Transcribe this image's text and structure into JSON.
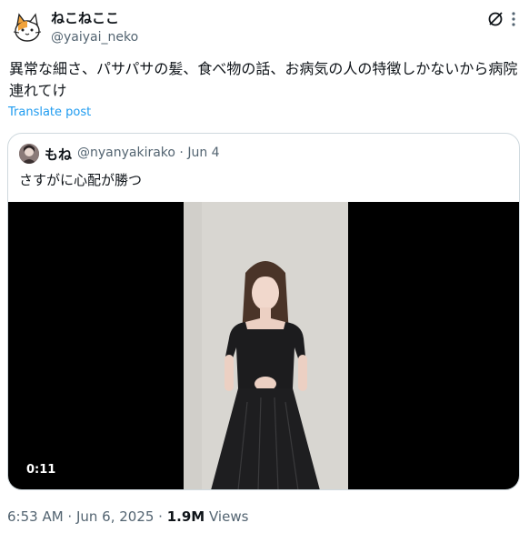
{
  "author": {
    "display_name": "ねこねここ",
    "handle": "@yaiyai_neko",
    "avatar_icon": "cat-avatar-icon"
  },
  "actions": {
    "grok_icon": "grok-icon",
    "more_icon": "more-icon"
  },
  "tweet": {
    "text": "異常な細さ、パサパサの髪、食べ物の話、お病気の人の特徴しかないから病院連れてけ",
    "translate_label": "Translate post"
  },
  "quote": {
    "display_name": "もね",
    "meta": "@nyanyakirako · Jun 4",
    "text": "さすがに心配が勝つ",
    "video_duration": "0:11"
  },
  "footer": {
    "timestamp": "6:53 AM · Jun 6, 2025 · ",
    "views_count": "1.9M",
    "views_label": " Views"
  },
  "colors": {
    "link": "#1d9bf0",
    "secondary_text": "#536471",
    "primary_text": "#0f1419",
    "border": "#cfd9de"
  }
}
